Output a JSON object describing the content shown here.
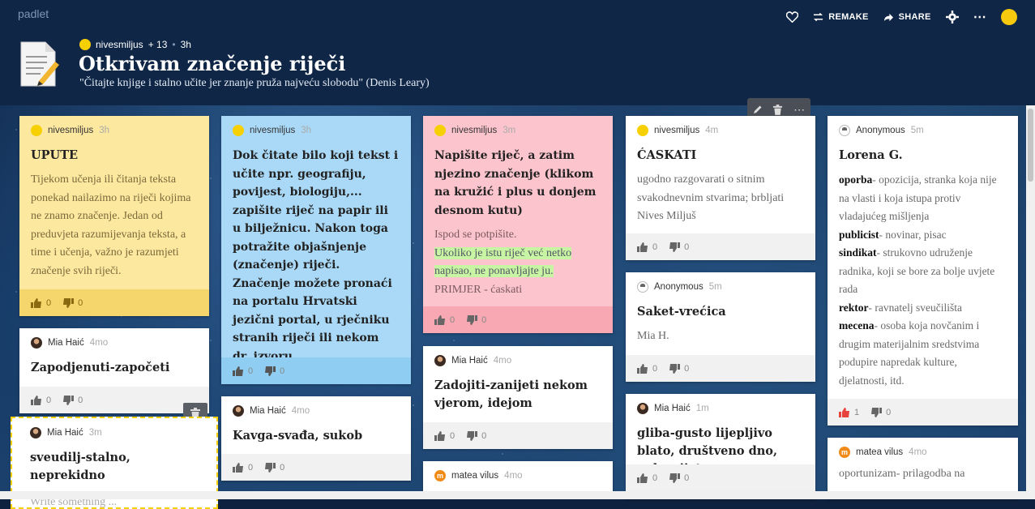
{
  "app": {
    "brand": "padlet"
  },
  "header": {
    "author": "nivesmiljus",
    "contributors": "+ 13",
    "age": "3h",
    "title": "Otkrivam značenje riječi",
    "subtitle": "\"Čitajte knjige i stalno učite jer znanje pruža najveću slobodu\" (Denis Leary)",
    "actions": {
      "remake": "REMAKE",
      "share": "SHARE"
    }
  },
  "colors": {
    "yellow_card": "#fde8a0",
    "blue_card": "#a9d9f7",
    "pink_card": "#fcc4cc",
    "header_bg": "#0f2646",
    "like_active": "#e8423c"
  },
  "cards": {
    "upute": {
      "author": "nivesmiljus",
      "time": "3h",
      "title": "UPUTE",
      "body": "Tijekom učenja ili čitanja teksta ponekad nailazimo na riječi kojima ne znamo značenje. Jedan od preduvjeta razumijevanja teksta, a time i učenja, važno je razumjeti značenje svih riječi.",
      "likes": "0",
      "dislikes": "0"
    },
    "zapodjenuti": {
      "author": "Mia Haić",
      "time": "4mo",
      "title": "Zapodjenuti-započeti",
      "likes": "0",
      "dislikes": "0"
    },
    "editing": {
      "author": "Mia Haić",
      "time": "3m",
      "title": "sveudilj-stalno, neprekidno",
      "placeholder": "Write something ..."
    },
    "dok_citate": {
      "author": "nivesmiljus",
      "time": "3h",
      "title": "Dok čitate bilo koji tekst i učite npr. geografiju, povijest, biologiju,... zapišite riječ na papir ili u bilježnicu. Nakon toga potražite objašnjenje (značenje) riječi. Značenje možete pronaći na portalu Hrvatski jezični portal, u rječniku stranih riječi ili nekom dr. izvoru",
      "likes": "0",
      "dislikes": "0"
    },
    "kavga": {
      "author": "Mia Haić",
      "time": "4mo",
      "title": "Kavga-svađa, sukob",
      "likes": "0",
      "dislikes": "0"
    },
    "napisite": {
      "author": "nivesmiljus",
      "time": "3m",
      "title": "Napišite riječ, a zatim njezino značenje (klikom na kružić i plus u donjem desnom kutu)",
      "line1": "Ispod se potpišite.",
      "highlight": "Ukoliko je istu riječ već netko napisao, ne ponavljajte ju.",
      "line3": "PRIMJER - ćaskati",
      "likes": "0",
      "dislikes": "0"
    },
    "zadojiti": {
      "author": "Mia Haić",
      "time": "4mo",
      "title": "Zadojiti-zanijeti nekom vjerom, idejom",
      "likes": "0",
      "dislikes": "0"
    },
    "matea_mid": {
      "author": "matea vilus",
      "time": "4mo"
    },
    "caskati": {
      "author": "nivesmiljus",
      "time": "4m",
      "title": "ĆASKATI",
      "body": "ugodno razgovarati o sitnim svakodnevnim stvarima; brbljati Nives Miljuš",
      "likes": "0",
      "dislikes": "0"
    },
    "saket": {
      "author": "Anonymous",
      "time": "5m",
      "title": "Saket-vrećica",
      "body": "Mia H.",
      "likes": "0",
      "dislikes": "0"
    },
    "gliba": {
      "author": "Mia Haić",
      "time": "1m",
      "title": "gliba-gusto lijepljivo blato, društveno dno, polusvijet",
      "likes": "0",
      "dislikes": "0"
    },
    "lorena": {
      "author": "Anonymous",
      "time": "5m",
      "title": "Lorena G.",
      "entries": [
        {
          "term": "oporba",
          "def": "- opozicija, stranka koja nije na vlasti i koja istupa protiv vladajućeg mišljenja"
        },
        {
          "term": "publicist",
          "def": "- novinar, pisac"
        },
        {
          "term": "sindikat",
          "def": "- strukovno udruženje radnika, koji se bore za bolje uvjete rada"
        },
        {
          "term": "rektor",
          "def": "- ravnatelj sveučilišta"
        },
        {
          "term": "mecena",
          "def": "- osoba koja novčanim i drugim materijalnim sredstvima podupire napredak kulture, djelatnosti, itd."
        }
      ],
      "likes": "1",
      "dislikes": "0"
    },
    "oportunizam": {
      "author": "matea vilus",
      "time": "4mo",
      "body": "oportunizam- prilagodba na"
    }
  }
}
